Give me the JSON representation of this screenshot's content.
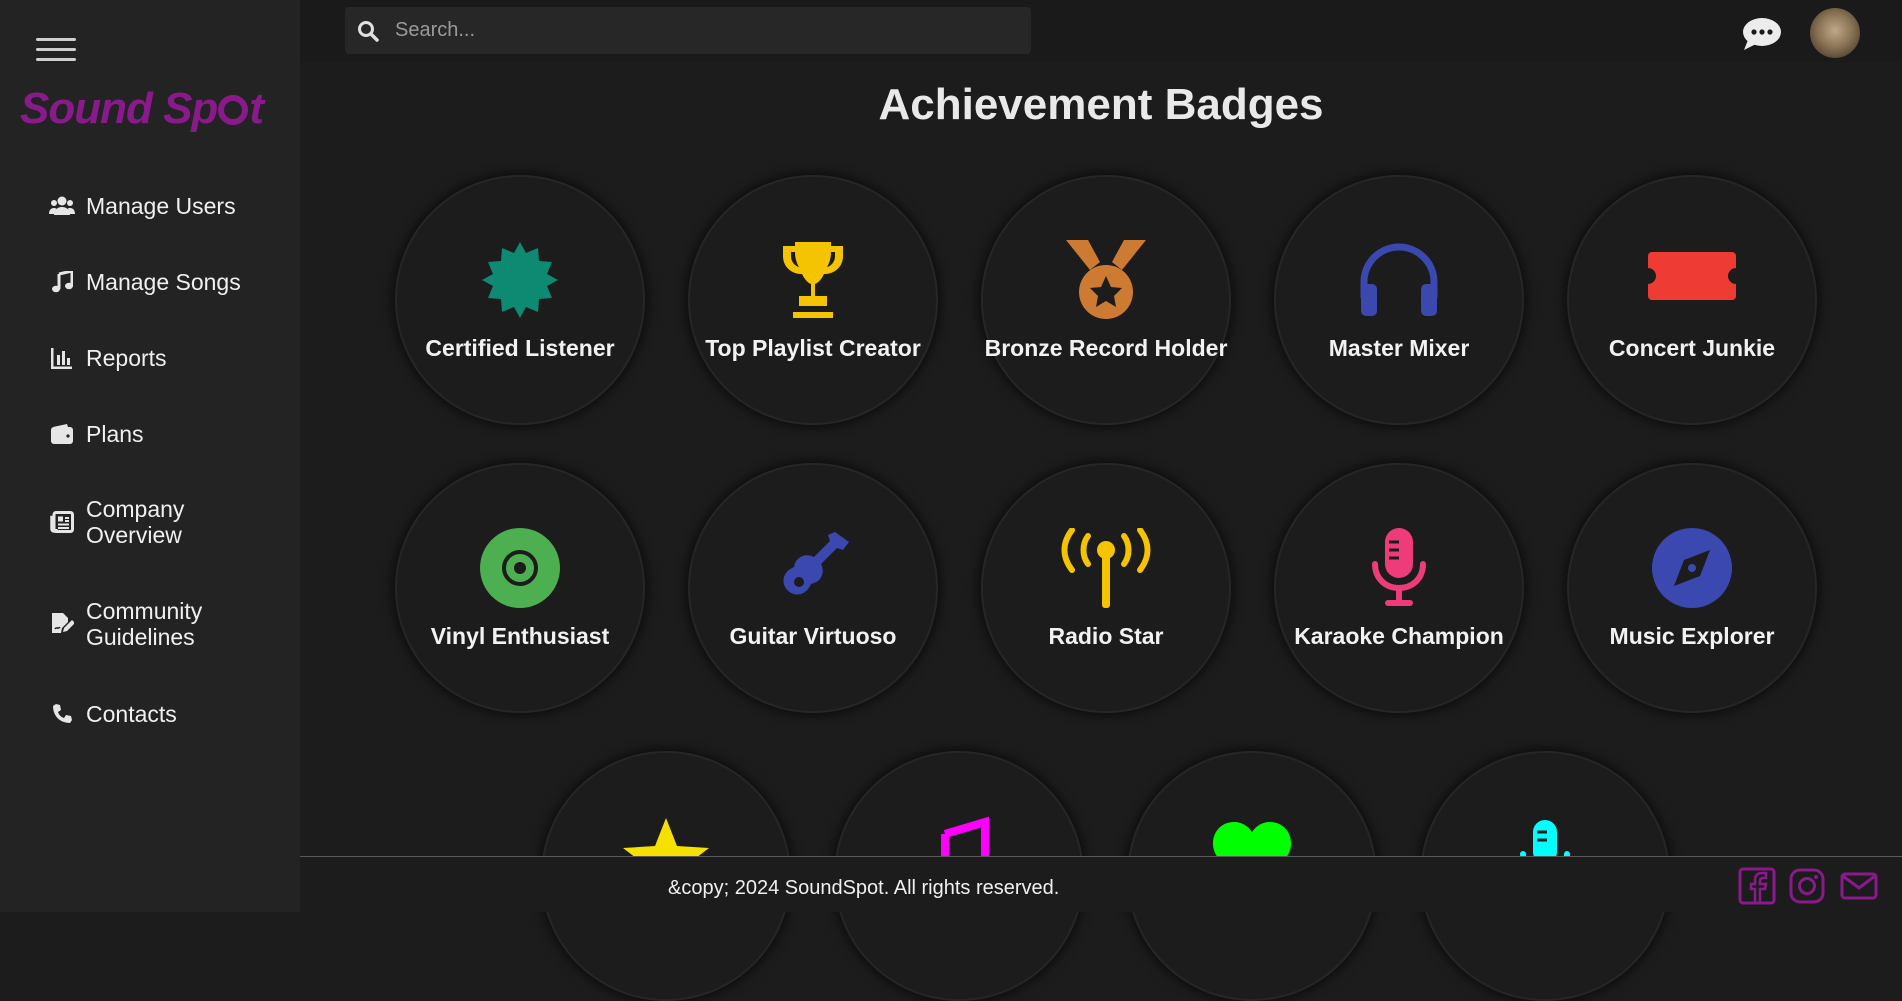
{
  "app": {
    "logo_text_1": "Sound Sp",
    "logo_text_2": "t"
  },
  "sidebar": {
    "items": [
      {
        "label": "Manage Users",
        "icon": "users-icon"
      },
      {
        "label": "Manage Songs",
        "icon": "music-note-icon"
      },
      {
        "label": "Reports",
        "icon": "bar-chart-icon"
      },
      {
        "label": "Plans",
        "icon": "wallet-icon"
      },
      {
        "label": "Company\nOverview",
        "icon": "newspaper-icon"
      },
      {
        "label": "Community\nGuidelines",
        "icon": "file-signature-icon"
      },
      {
        "label": "Contacts",
        "icon": "phone-icon"
      }
    ]
  },
  "search": {
    "placeholder": "Search..."
  },
  "page": {
    "title": "Achievement Badges"
  },
  "badges": [
    {
      "label": "Certified Listener",
      "icon": "certificate-icon",
      "color": "#0e8a72"
    },
    {
      "label": "Top Playlist Creator",
      "icon": "trophy-icon",
      "color": "#f5c400"
    },
    {
      "label": "Bronze Record Holder",
      "icon": "medal-icon",
      "color": "#cd7a32"
    },
    {
      "label": "Master Mixer",
      "icon": "headphones-icon",
      "color": "#3a48b0"
    },
    {
      "label": "Concert Junkie",
      "icon": "ticket-icon",
      "color": "#ee3c35"
    },
    {
      "label": "Vinyl Enthusiast",
      "icon": "record-icon",
      "color": "#4caf50"
    },
    {
      "label": "Guitar Virtuoso",
      "icon": "guitar-icon",
      "color": "#3a48b0"
    },
    {
      "label": "Radio Star",
      "icon": "radio-tower-icon",
      "color": "#f5c400"
    },
    {
      "label": "Karaoke Champion",
      "icon": "microphone-icon",
      "color": "#ee3c7a"
    },
    {
      "label": "Music Explorer",
      "icon": "compass-icon",
      "color": "#3a48b0"
    },
    {
      "label": "",
      "icon": "star-icon",
      "color": "#f5e000"
    },
    {
      "label": "",
      "icon": "music-icon",
      "color": "#ff00ff"
    },
    {
      "label": "",
      "icon": "heart-icon",
      "color": "#00ff00"
    },
    {
      "label": "",
      "icon": "podcast-mic-icon",
      "color": "#00ffff"
    }
  ],
  "footer": {
    "copyright": "&copy; 2024 SoundSpot. All rights reserved.",
    "social": [
      {
        "icon": "facebook-icon"
      },
      {
        "icon": "instagram-icon"
      },
      {
        "icon": "email-icon"
      }
    ],
    "social_color": "#8a1a8c"
  }
}
